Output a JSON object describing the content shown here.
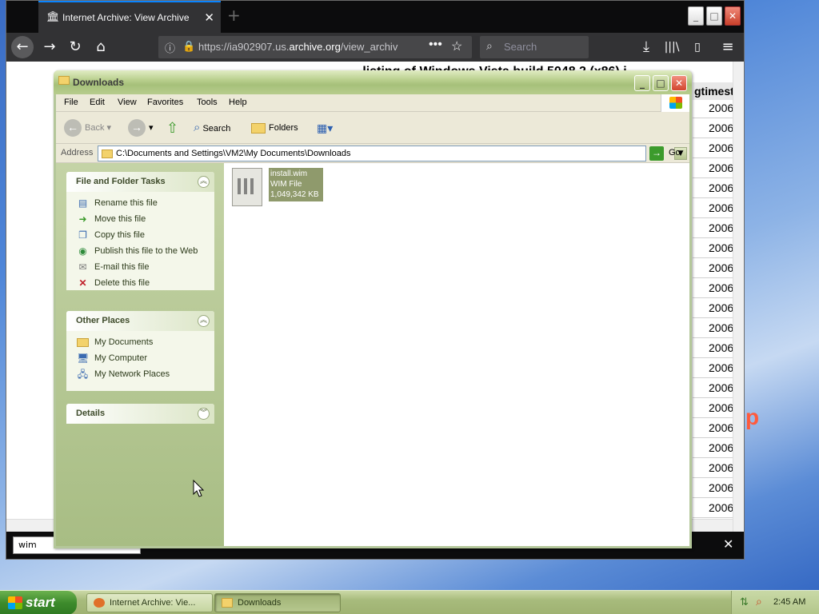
{
  "firefox": {
    "tab_title": "Internet Archive: View Archive",
    "url_prefix": "https://ia902907.us.",
    "url_domain": "archive.org",
    "url_suffix": "/view_archiv",
    "search_placeholder": "Search",
    "page_heading": "...listing of Windows Vista build 5048 2 (x86) i...",
    "column_header": "gtimest",
    "timestamp_cells": [
      "2006",
      "2006",
      "2006",
      "2006",
      "2006",
      "2006",
      "2006",
      "2006",
      "2006",
      "2006",
      "2006",
      "2006",
      "2006",
      "2006",
      "2006",
      "2006",
      "2006",
      "2006",
      "2006",
      "2006",
      "2006"
    ],
    "find_text": "wim"
  },
  "explorer": {
    "title": "Downloads",
    "menu": [
      "File",
      "Edit",
      "View",
      "Favorites",
      "Tools",
      "Help"
    ],
    "toolbar": {
      "back": "Back",
      "search": "Search",
      "folders": "Folders"
    },
    "address_label": "Address",
    "address_path": "C:\\Documents and Settings\\VM2\\My Documents\\Downloads",
    "go_label": "Go",
    "file_tasks": {
      "title": "File and Folder Tasks",
      "items": [
        "Rename this file",
        "Move this file",
        "Copy this file",
        "Publish this file to the Web",
        "E-mail this file",
        "Delete this file"
      ]
    },
    "other_places": {
      "title": "Other Places",
      "items": [
        "My Documents",
        "My Computer",
        "My Network Places"
      ]
    },
    "details": {
      "title": "Details"
    },
    "file": {
      "name": "install.wim",
      "type": "WIM File",
      "size": "1,049,342 KB"
    }
  },
  "taskbar": {
    "start_label": "start",
    "tasks": [
      "Internet Archive: Vie...",
      "Downloads"
    ],
    "clock": "2:45 AM"
  },
  "colors": {
    "xp_olive": "#a6c07a",
    "firefox_dark": "#0c0c0d",
    "accent_blue": "#0a84ff"
  }
}
